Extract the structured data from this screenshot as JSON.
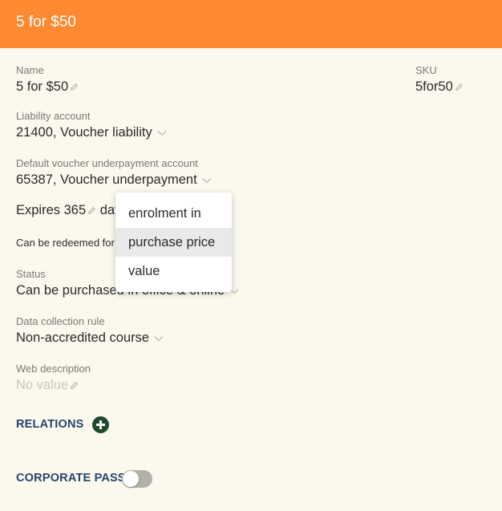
{
  "header": {
    "title": "5 for $50"
  },
  "fields": {
    "name": {
      "label": "Name",
      "value": "5 for $50"
    },
    "sku": {
      "label": "SKU",
      "value": "5for50"
    },
    "liability": {
      "label": "Liability account",
      "value": "21400, Voucher liability"
    },
    "underpayment": {
      "label": "Default voucher underpayment account",
      "value": "65387, Voucher underpayment"
    },
    "expires": {
      "prefix": "Expires",
      "value": "365",
      "unit": "day"
    },
    "redeem": {
      "text": "Can be redeemed for"
    },
    "status": {
      "label": "Status",
      "value": "Can be purchased in office & online"
    },
    "data_rule": {
      "label": "Data collection rule",
      "value": "Non-accredited course"
    },
    "web_desc": {
      "label": "Web description",
      "value": "No value"
    }
  },
  "sections": {
    "relations": "RELATIONS",
    "corporate_pass": "CORPORATE PASS"
  },
  "menu": {
    "items": [
      "enrolment in",
      "purchase price",
      "value"
    ],
    "selected_index": 1
  },
  "toggle": {
    "on": false
  },
  "colors": {
    "header": "#fd8a33",
    "background": "#fbf8ee",
    "section": "#23456a",
    "add": "#1e4b2b"
  },
  "icons": {
    "edit": "pencil-icon",
    "dropdown": "chevron-down-icon",
    "add": "plus-circle-icon"
  }
}
